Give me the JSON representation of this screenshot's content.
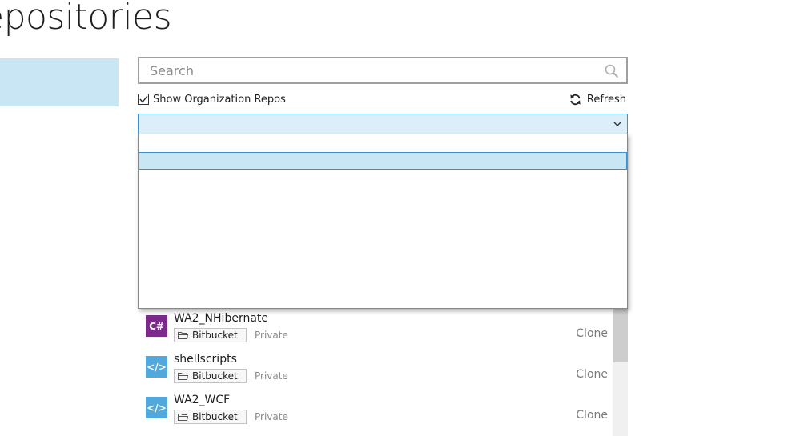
{
  "page": {
    "title": "epositories"
  },
  "search": {
    "placeholder": "Search",
    "value": ""
  },
  "org_toggle": {
    "label": "Show Organization Repos",
    "checked": true
  },
  "refresh": {
    "label": "Refresh"
  },
  "filter_combo": {
    "selected": "",
    "options": [
      "",
      ""
    ]
  },
  "repos": [
    {
      "name": "WA2_NHibernate",
      "icon": "csharp-icon",
      "icon_text": "C#",
      "host": "Bitbucket",
      "privacy": "Private",
      "action": "Clone"
    },
    {
      "name": "shellscripts",
      "icon": "code-icon",
      "icon_text": "</>",
      "host": "Bitbucket",
      "privacy": "Private",
      "action": "Clone"
    },
    {
      "name": "WA2_WCF",
      "icon": "code-icon",
      "icon_text": "</>",
      "host": "Bitbucket",
      "privacy": "Private",
      "action": "Clone"
    }
  ],
  "colors": {
    "accent": "#3c8fd0",
    "selection": "#c9e6f5",
    "csharp": "#7b2a8c",
    "code": "#52a7dc"
  }
}
